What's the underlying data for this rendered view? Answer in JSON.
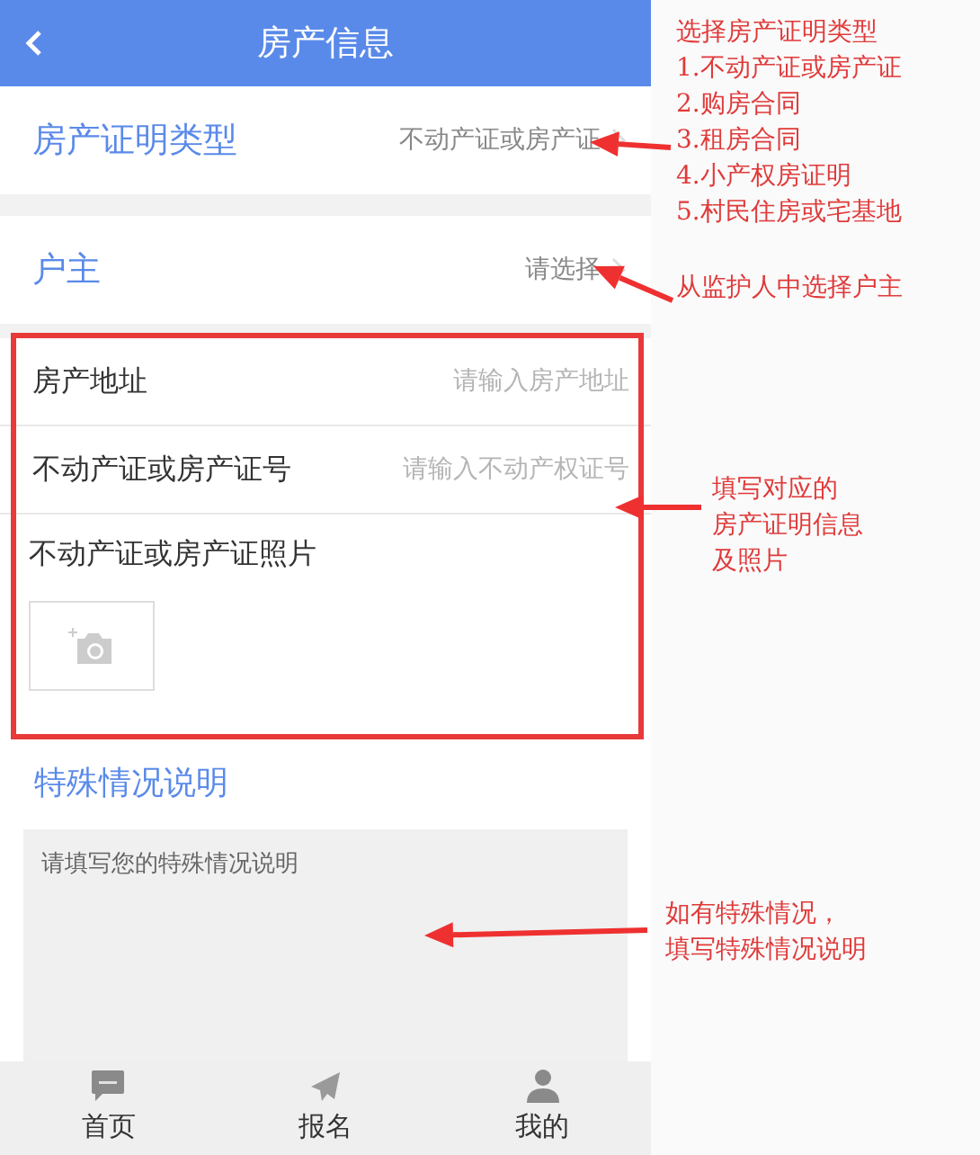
{
  "header": {
    "title": "房产信息"
  },
  "selects": [
    {
      "label": "房产证明类型",
      "value": "不动产证或房产证"
    },
    {
      "label": "户主",
      "value": "请选择"
    }
  ],
  "fields": [
    {
      "label": "房产地址",
      "placeholder": "请输入房产地址"
    },
    {
      "label": "不动产证或房产证号",
      "placeholder": "请输入不动产权证号"
    }
  ],
  "photo": {
    "label": "不动产证或房产证照片"
  },
  "special": {
    "title": "特殊情况说明",
    "placeholder": "请填写您的特殊情况说明"
  },
  "tab_bar": [
    {
      "label": "首页"
    },
    {
      "label": "报名"
    },
    {
      "label": "我的"
    }
  ],
  "annotations": [
    {
      "lines": [
        "选择房产证明类型",
        "1.不动产证或房产证",
        "2.购房合同",
        "3.租房合同",
        "4.小产权房证明",
        "5.村民住房或宅基地"
      ]
    },
    {
      "lines": [
        "从监护人中选择户主"
      ]
    },
    {
      "lines": [
        "填写对应的",
        "房产证明信息",
        "及照片"
      ]
    },
    {
      "lines": [
        "如有特殊情况，",
        "填写特殊情况说明"
      ]
    }
  ]
}
